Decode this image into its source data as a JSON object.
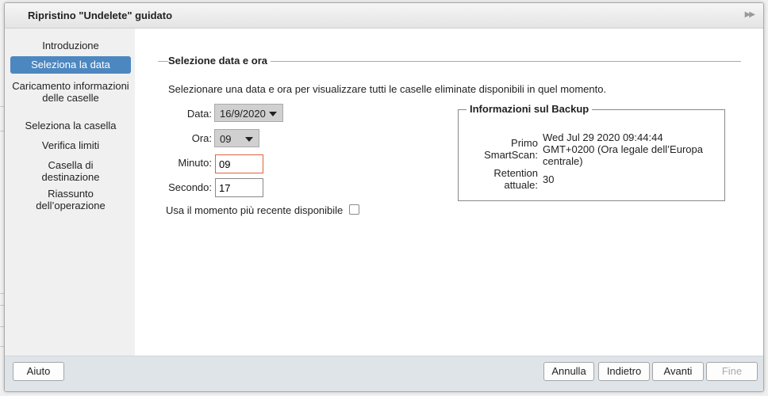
{
  "window": {
    "title": "Ripristino \"Undelete\" guidato"
  },
  "sidebar": {
    "items": [
      {
        "label": "Introduzione"
      },
      {
        "label": "Seleziona la data"
      },
      {
        "label": "Caricamento informazioni delle caselle"
      },
      {
        "label": "Seleziona la casella"
      },
      {
        "label": "Verifica limiti"
      },
      {
        "label": "Casella di destinazione"
      },
      {
        "label": "Riassunto dell’operazione"
      }
    ],
    "active": "Seleziona la data"
  },
  "main": {
    "section_title": "Selezione data e ora",
    "intro": "Selezionare una data e ora per visualizzare tutti le caselle eliminate disponibili in quel momento.",
    "fields": {
      "date_label": "Data:",
      "date_value": "16/9/2020",
      "hour_label": "Ora:",
      "hour_value": "09",
      "minute_label": "Minuto:",
      "minute_value": "09",
      "second_label": "Secondo:",
      "second_value": "17"
    },
    "latest_checkbox_label": "Usa il momento più recente disponibile",
    "latest_checked": false,
    "backup_info": {
      "title": "Informazioni sul Backup",
      "first_scan_label": "Primo SmartScan:",
      "first_scan_value": "Wed Jul 29 2020 09:44:44 GMT+0200 (Ora legale dell’Europa centrale)",
      "retention_label": "Retention attuale:",
      "retention_value": "30"
    }
  },
  "footer": {
    "help": "Aiuto",
    "cancel": "Annulla",
    "back": "Indietro",
    "next": "Avanti",
    "finish": "Fine"
  }
}
